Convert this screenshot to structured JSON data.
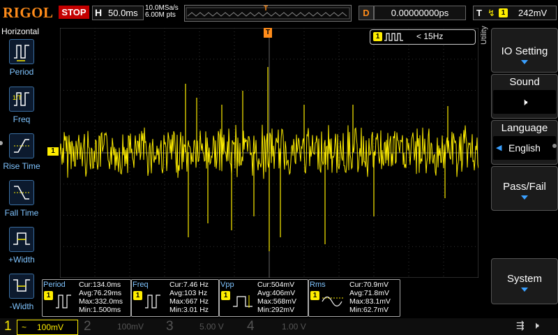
{
  "header": {
    "logo": "RIGOL",
    "run_status": "STOP",
    "horizontal_label": "H",
    "timebase": "50.0ms",
    "sample_rate": "10.0MSa/s",
    "memory_depth": "6.00M pts",
    "trigger_marker": "T",
    "delay_label": "D",
    "delay_value": "0.00000000ps",
    "trigger_label": "T",
    "trigger_channel": "1",
    "trigger_level": "242mV"
  },
  "left_menu": {
    "title": "Horizontal",
    "items": [
      {
        "label": "Period",
        "icon": "period-icon"
      },
      {
        "label": "Freq",
        "icon": "freq-icon"
      },
      {
        "label": "Rise Time",
        "icon": "rise-time-icon"
      },
      {
        "label": "Fall Time",
        "icon": "fall-time-icon"
      },
      {
        "label": "+Width",
        "icon": "positive-width-icon"
      },
      {
        "label": "-Width",
        "icon": "negative-width-icon"
      }
    ]
  },
  "screen": {
    "channel_marker": "1",
    "trigger_top_marker": "T",
    "freq_badge_channel": "1",
    "freq_text": "< 15Hz"
  },
  "right_menu": {
    "side_label": "Utility",
    "io_setting": "IO Setting",
    "sound": "Sound",
    "language": "Language",
    "language_value": "English",
    "pass_fail": "Pass/Fail",
    "system": "System"
  },
  "measurements": [
    {
      "name": "Period",
      "channel": "1",
      "cur": "Cur:134.0ms",
      "avg": "Avg:76.29ms",
      "max": "Max:332.0ms",
      "min": "Min:1.500ms"
    },
    {
      "name": "Freq",
      "channel": "1",
      "cur": "Cur:7.46 Hz",
      "avg": "Avg:103 Hz",
      "max": "Max:667 Hz",
      "min": "Min:3.01 Hz"
    },
    {
      "name": "Vpp",
      "channel": "1",
      "cur": "Cur:504mV",
      "avg": "Avg:406mV",
      "max": "Max:568mV",
      "min": "Min:292mV"
    },
    {
      "name": "Rms",
      "channel": "1",
      "cur": "Cur:70.9mV",
      "avg": "Avg:71.8mV",
      "max": "Max:83.1mV",
      "min": "Min:62.7mV"
    }
  ],
  "channels": [
    {
      "num": "1",
      "coupling": "~",
      "scale": "100mV",
      "color": "#ffee00"
    },
    {
      "num": "2",
      "coupling": "",
      "scale": "100mV",
      "color": "#00e5ff"
    },
    {
      "num": "3",
      "coupling": "",
      "scale": "5.00 V",
      "color": "#ff33ff"
    },
    {
      "num": "4",
      "coupling": "",
      "scale": "1.00 V",
      "color": "#3377ff"
    }
  ],
  "colors": {
    "ch1": "#ffee00",
    "accent_orange": "#ff8c1a",
    "menu_blue": "#7fc4ff"
  }
}
